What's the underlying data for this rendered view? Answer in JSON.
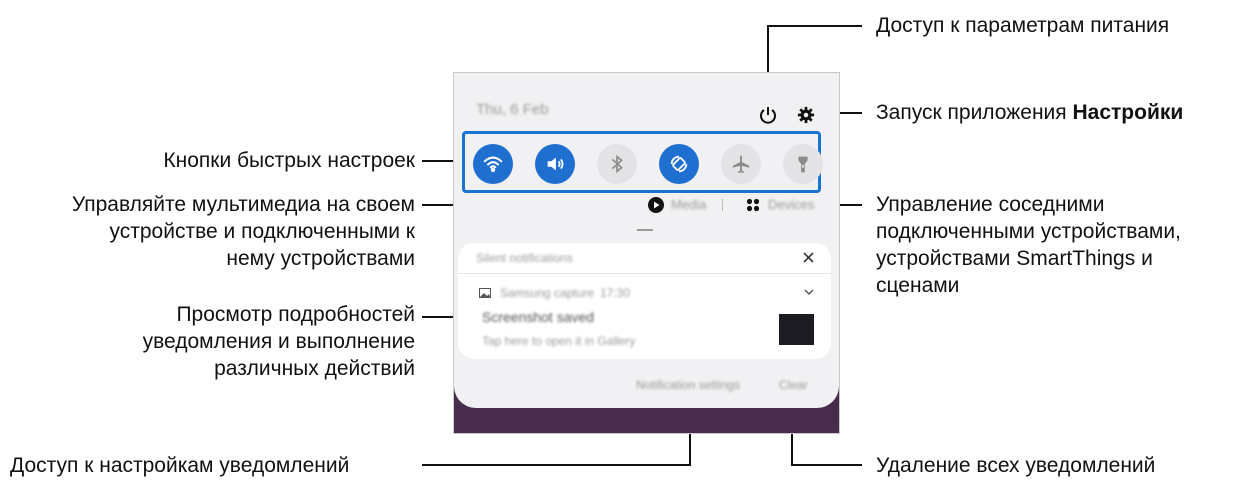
{
  "labels": {
    "power": "Доступ к параметрам питания",
    "settings_prefix": "Запуск приложения ",
    "settings_bold": "Настройки",
    "quick_buttons": "Кнопки быстрых настроек",
    "media_line1": "Управляйте мультимедиа на своем",
    "media_line2": "устройстве и подключенными к",
    "media_line3": "нему устройствами",
    "devices_line1": "Управление соседними",
    "devices_line2": "подключенными устройствами,",
    "devices_line3": "устройствами SmartThings и",
    "devices_line4": "сценами",
    "notif_line1": "Просмотр подробностей",
    "notif_line2": "уведомления и выполнение",
    "notif_line3": "различных действий",
    "notif_settings": "Доступ к настройкам уведомлений",
    "clear_all": "Удаление всех уведомлений"
  },
  "panel": {
    "date": "Thu, 6 Feb",
    "media": "Media",
    "devices": "Devices",
    "silent": "Silent notifications",
    "app_name": "Samsung capture",
    "time": "17:30",
    "notif_title": "Screenshot saved",
    "notif_text": "Tap here to open it in Gallery",
    "notif_settings_btn": "Notification settings",
    "clear_btn": "Clear"
  },
  "quick_settings": [
    {
      "name": "wifi",
      "state": "on"
    },
    {
      "name": "sound",
      "state": "on"
    },
    {
      "name": "bluetooth",
      "state": "off"
    },
    {
      "name": "auto-rotate",
      "state": "on"
    },
    {
      "name": "airplane-mode",
      "state": "off"
    },
    {
      "name": "flashlight",
      "state": "off"
    }
  ],
  "colors": {
    "accent": "#1f6fd0",
    "callout_line": "#111111"
  }
}
